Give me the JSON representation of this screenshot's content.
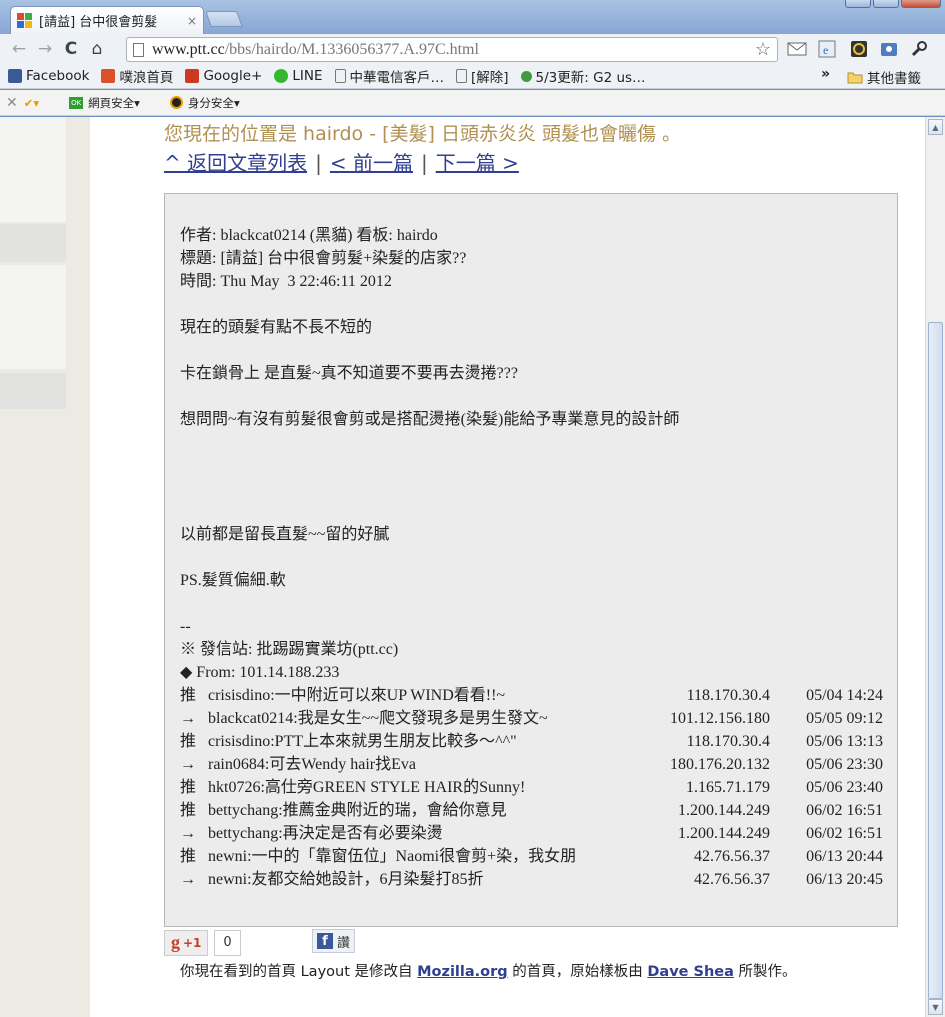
{
  "tab": {
    "title": "[請益] 台中很會剪髮",
    "close": "×"
  },
  "nav": {
    "back": "←",
    "forward": "→",
    "reload": "C",
    "home": "⌂"
  },
  "address": {
    "host": "www.ptt.cc",
    "path": "/bbs/hairdo/M.1336056377.A.97C.html",
    "star": "☆"
  },
  "bookmarks": {
    "items": [
      {
        "label": "Facebook",
        "color": "#3b5998"
      },
      {
        "label": "噗浪首頁",
        "color": "#d9502b"
      },
      {
        "label": "Google+",
        "color": "#cc3a24"
      },
      {
        "label": "LINE",
        "color": "#35b82d"
      },
      {
        "label": "中華電信客戶…",
        "color": "#ffffff"
      },
      {
        "label": "[解除]",
        "color": "#ffffff"
      },
      {
        "label": "5/3更新: G2 us…",
        "color": "#3f9c3a"
      }
    ],
    "more": "»",
    "other": "其他書籤"
  },
  "security_bar": {
    "web_safety": "網頁安全",
    "identity_safety": "身分安全"
  },
  "page": {
    "location": "您現在的位置是 hairdo - [美髮] 日頭赤炎炎 頭髮也會曬傷 。",
    "nav_back": "^ 返回文章列表",
    "nav_prev": "< 前一篇",
    "nav_next": "下一篇 >",
    "sep": "|"
  },
  "post": {
    "header_author": "作者: blackcat0214 (黑貓) 看板: hairdo",
    "header_title": "標題: [請益] 台中很會剪髮+染髮的店家??",
    "header_time": "時間: Thu May  3 22:46:11 2012",
    "body1": "現在的頭髮有點不長不短的",
    "body2": "卡在鎖骨上 是直髮~真不知道要不要再去燙捲???",
    "body3": "想問問~有沒有剪髮很會剪或是搭配燙捲(染髮)能給予專業意見的設計師",
    "body4": "以前都是留長直髮~~留的好膩",
    "body5": "PS.髮質偏細.軟",
    "sig_dash": "--",
    "sig_site": "※ 發信站: 批踢踢實業坊(ptt.cc)",
    "sig_from": "◆ From: 101.14.188.233",
    "pushes": [
      {
        "tag": "推",
        "text": "crisisdino:一中附近可以來UP WIND看看!!~",
        "ip": "118.170.30.4",
        "time": "05/04 14:24"
      },
      {
        "tag": "→",
        "text": "blackcat0214:我是女生~~爬文發現多是男生發文~",
        "ip": "101.12.156.180",
        "time": "05/05 09:12"
      },
      {
        "tag": "推",
        "text": "crisisdino:PTT上本來就男生朋友比較多～^^\"",
        "ip": "118.170.30.4",
        "time": "05/06 13:13"
      },
      {
        "tag": "→",
        "text": "rain0684:可去Wendy hair找Eva",
        "ip": "180.176.20.132",
        "time": "05/06 23:30"
      },
      {
        "tag": "推",
        "text": "hkt0726:高仕旁GREEN STYLE HAIR的Sunny!",
        "ip": "1.165.71.179",
        "time": "05/06 23:40"
      },
      {
        "tag": "推",
        "text": "bettychang:推薦金典附近的瑞，會給你意見",
        "ip": "1.200.144.249",
        "time": "06/02 16:51"
      },
      {
        "tag": "→",
        "text": "bettychang:再決定是否有必要染燙",
        "ip": "1.200.144.249",
        "time": "06/02 16:51"
      },
      {
        "tag": "推",
        "text": "newni:一中的「靠窗伍位」Naomi很會剪+染，我女朋",
        "ip": "42.76.56.37",
        "time": "06/13 20:44"
      },
      {
        "tag": "→",
        "text": "newni:友都交給她設計，6月染髮打85折",
        "ip": "42.76.56.37",
        "time": "06/13 20:45"
      }
    ]
  },
  "social": {
    "gplus_label": "+1",
    "gplus_count": "0",
    "fb_label": "讚"
  },
  "footer": {
    "prefix": "你現在看到的首頁 Layout 是修改自 ",
    "link1": "Mozilla.org",
    "middle": " 的首頁，原始樣板由 ",
    "link2": "Dave Shea",
    "suffix": " 所製作。"
  }
}
